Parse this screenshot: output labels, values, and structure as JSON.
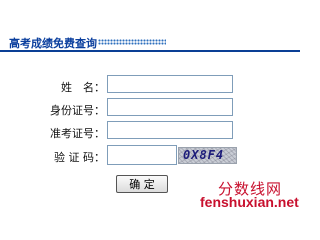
{
  "header": {
    "title": "高考成绩免费查询"
  },
  "form": {
    "name_label": "姓　名：",
    "id_label": "身份证号：",
    "exam_label": "准考证号：",
    "captcha_label": "验 证 码：",
    "name_value": "",
    "id_value": "",
    "exam_value": "",
    "captcha_value": "",
    "captcha_text": "0X8F4",
    "submit_label": "确 定"
  },
  "watermark": {
    "chinese": "分数线网",
    "url": "fenshuxian.net"
  },
  "colors": {
    "title": "#0b3f9e",
    "rule": "#0a3f95",
    "input_border": "#7f9db9",
    "watermark": "#c8102e"
  }
}
